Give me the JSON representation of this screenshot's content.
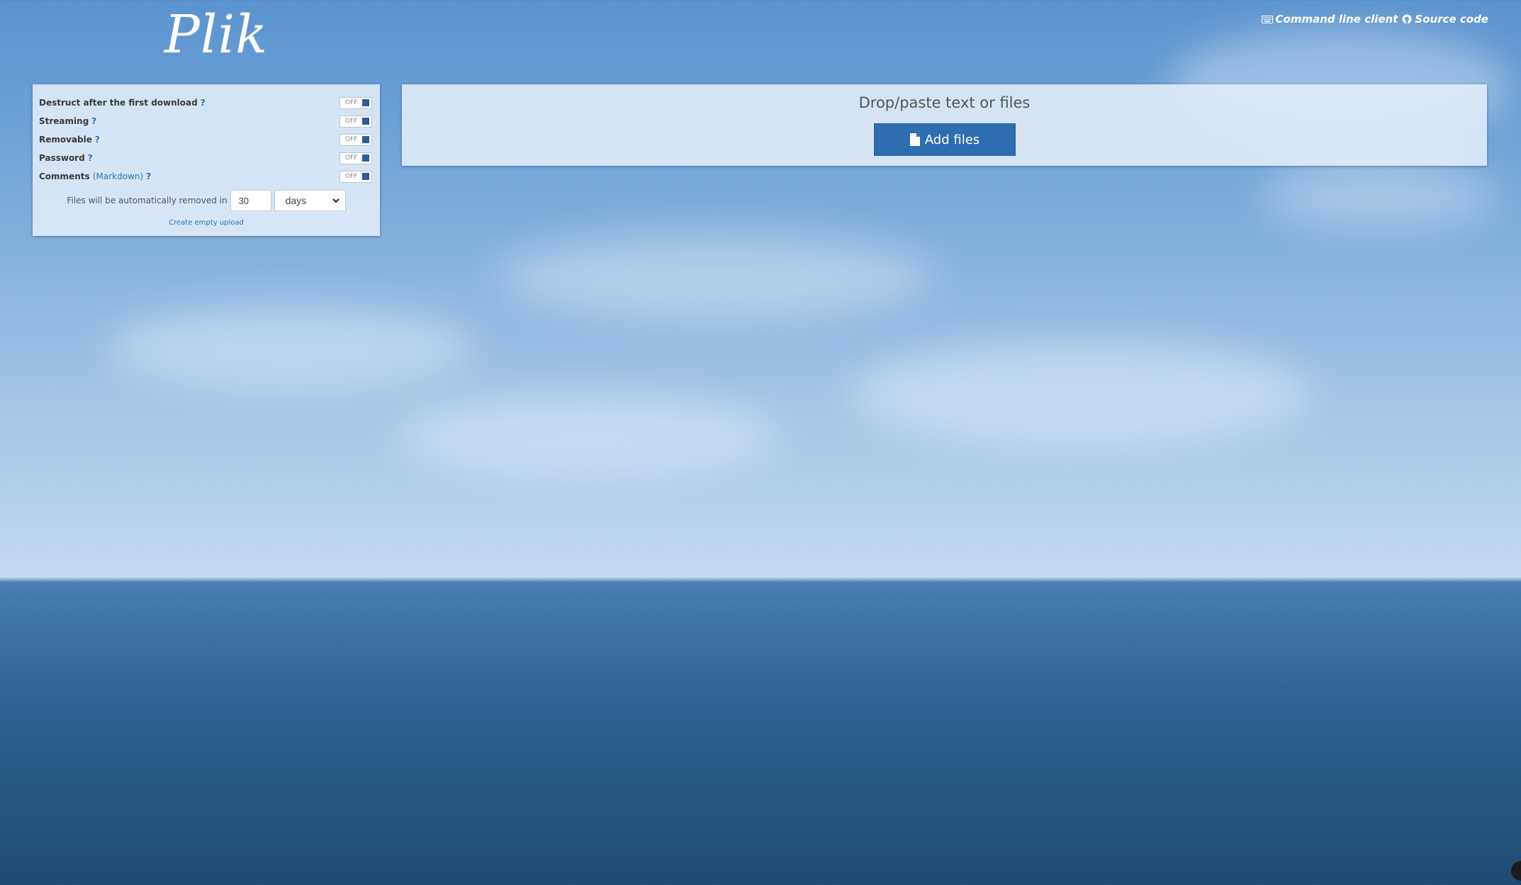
{
  "header": {
    "logo": "Plik",
    "cli_link": "Command line client",
    "cli_icon": "keyboard-icon",
    "source_link": "Source code",
    "source_icon": "github-icon"
  },
  "options": {
    "items": [
      {
        "label": "Destruct after the first download",
        "help": "?",
        "state": "OFF"
      },
      {
        "label": "Streaming",
        "help": "?",
        "state": "OFF"
      },
      {
        "label": "Removable",
        "help": "?",
        "state": "OFF"
      },
      {
        "label": "Password",
        "help": "?",
        "state": "OFF"
      },
      {
        "label": "Comments",
        "link": "Markdown",
        "open_paren": "(",
        "close_paren": ")",
        "help": "?",
        "state": "OFF"
      }
    ],
    "ttl_label": "Files will be automatically removed in",
    "ttl_value": "30",
    "ttl_unit": "days",
    "empty_upload": "Create empty upload"
  },
  "drop": {
    "title": "Drop/paste text or files",
    "button_label": "Add files",
    "button_icon": "file-icon"
  },
  "colors": {
    "accent": "#2e6db0",
    "toggle_knob": "#2d5a9a",
    "link": "#2d6fb4"
  }
}
